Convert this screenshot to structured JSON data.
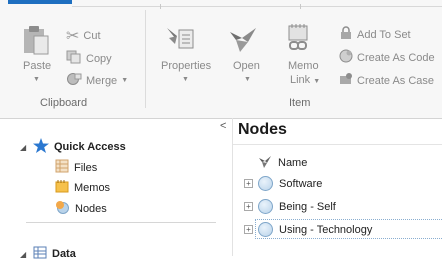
{
  "ribbon": {
    "clipboard": {
      "paste_label": "Paste",
      "cut_label": "Cut",
      "copy_label": "Copy",
      "merge_label": "Merge",
      "group_label": "Clipboard"
    },
    "item": {
      "properties_label": "Properties",
      "open_label": "Open",
      "memo_link_label_line1": "Memo",
      "memo_link_label_line2": "Link",
      "add_to_set_label": "Add To Set",
      "create_as_code_label": "Create As Code",
      "create_as_case_label": "Create As Case",
      "group_label": "Item"
    }
  },
  "navigation": {
    "quick_access_label": "Quick Access",
    "items": [
      "Files",
      "Memos",
      "Nodes"
    ],
    "data_label": "Data"
  },
  "nodes_panel": {
    "title": "Nodes",
    "column_name": "Name",
    "rows": [
      "Software",
      "Being - Self",
      "Using - Technology"
    ]
  },
  "colors": {
    "accent": "#1e6fc0",
    "selection_border": "#8aaed0"
  }
}
